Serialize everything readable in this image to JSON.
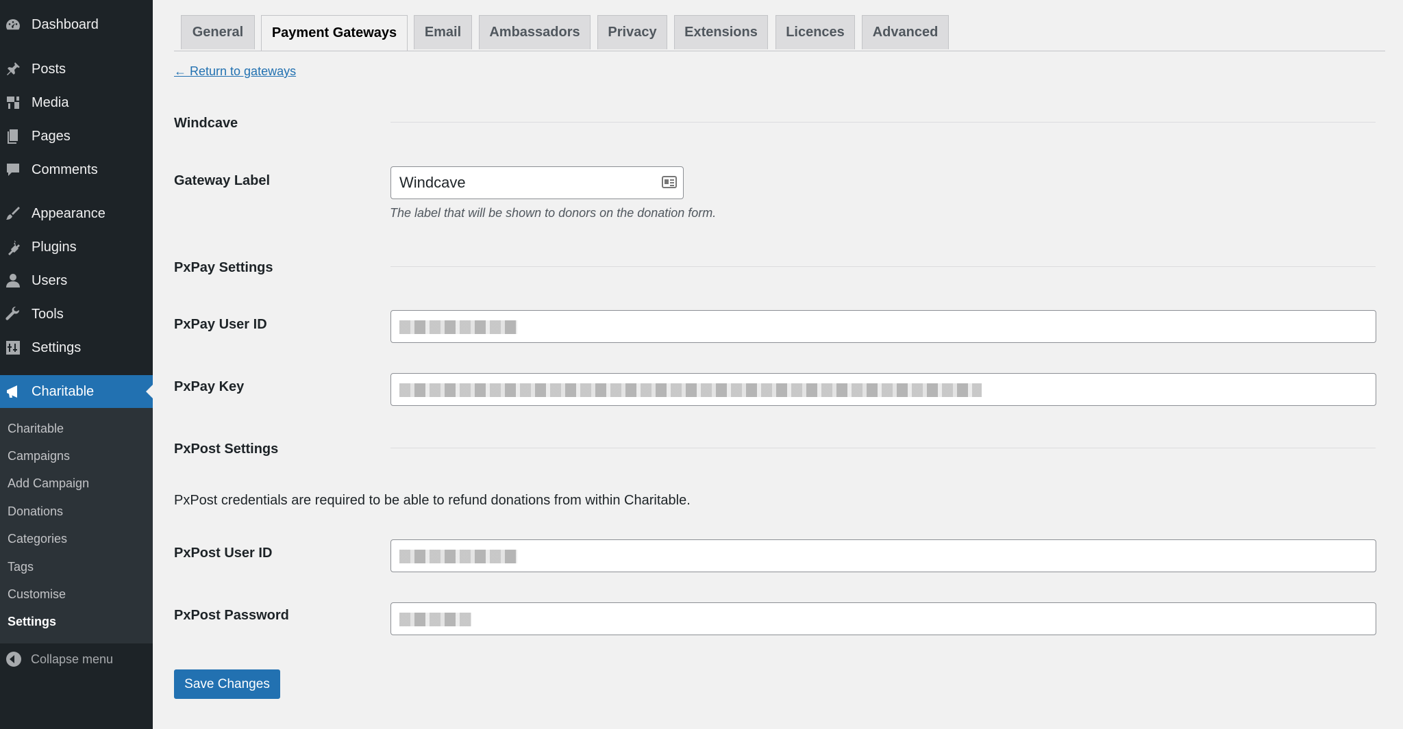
{
  "sidebar": {
    "menu": [
      {
        "label": "Dashboard",
        "icon": "dashboard-icon"
      },
      {
        "label": "Posts",
        "icon": "pin-icon"
      },
      {
        "label": "Media",
        "icon": "media-icon"
      },
      {
        "label": "Pages",
        "icon": "pages-icon"
      },
      {
        "label": "Comments",
        "icon": "comment-icon"
      },
      {
        "label": "Appearance",
        "icon": "brush-icon"
      },
      {
        "label": "Plugins",
        "icon": "plugin-icon"
      },
      {
        "label": "Users",
        "icon": "user-icon"
      },
      {
        "label": "Tools",
        "icon": "wrench-icon"
      },
      {
        "label": "Settings",
        "icon": "settings-icon"
      },
      {
        "label": "Charitable",
        "icon": "megaphone-icon"
      }
    ],
    "submenu": [
      "Charitable",
      "Campaigns",
      "Add Campaign",
      "Donations",
      "Categories",
      "Tags",
      "Customise",
      "Settings"
    ],
    "collapse_label": "Collapse menu"
  },
  "tabs": [
    "General",
    "Payment Gateways",
    "Email",
    "Ambassadors",
    "Privacy",
    "Extensions",
    "Licences",
    "Advanced"
  ],
  "active_tab": "Payment Gateways",
  "content": {
    "back_link": "← Return to gateways",
    "section_windcave": "Windcave",
    "gateway_label": {
      "label": "Gateway Label",
      "value": "Windcave",
      "description": "The label that will be shown to donors on the donation form."
    },
    "section_pxpay": "PxPay Settings",
    "pxpay_user_id": {
      "label": "PxPay User ID"
    },
    "pxpay_key": {
      "label": "PxPay Key"
    },
    "section_pxpost": "PxPost Settings",
    "pxpost_intro": "PxPost credentials are required to be able to refund donations from within Charitable.",
    "pxpost_user_id": {
      "label": "PxPost User ID"
    },
    "pxpost_password": {
      "label": "PxPost Password"
    },
    "save_label": "Save Changes"
  },
  "colors": {
    "sidebar_bg": "#1d2327",
    "accent": "#2271b1",
    "page_bg": "#f1f1f1"
  }
}
